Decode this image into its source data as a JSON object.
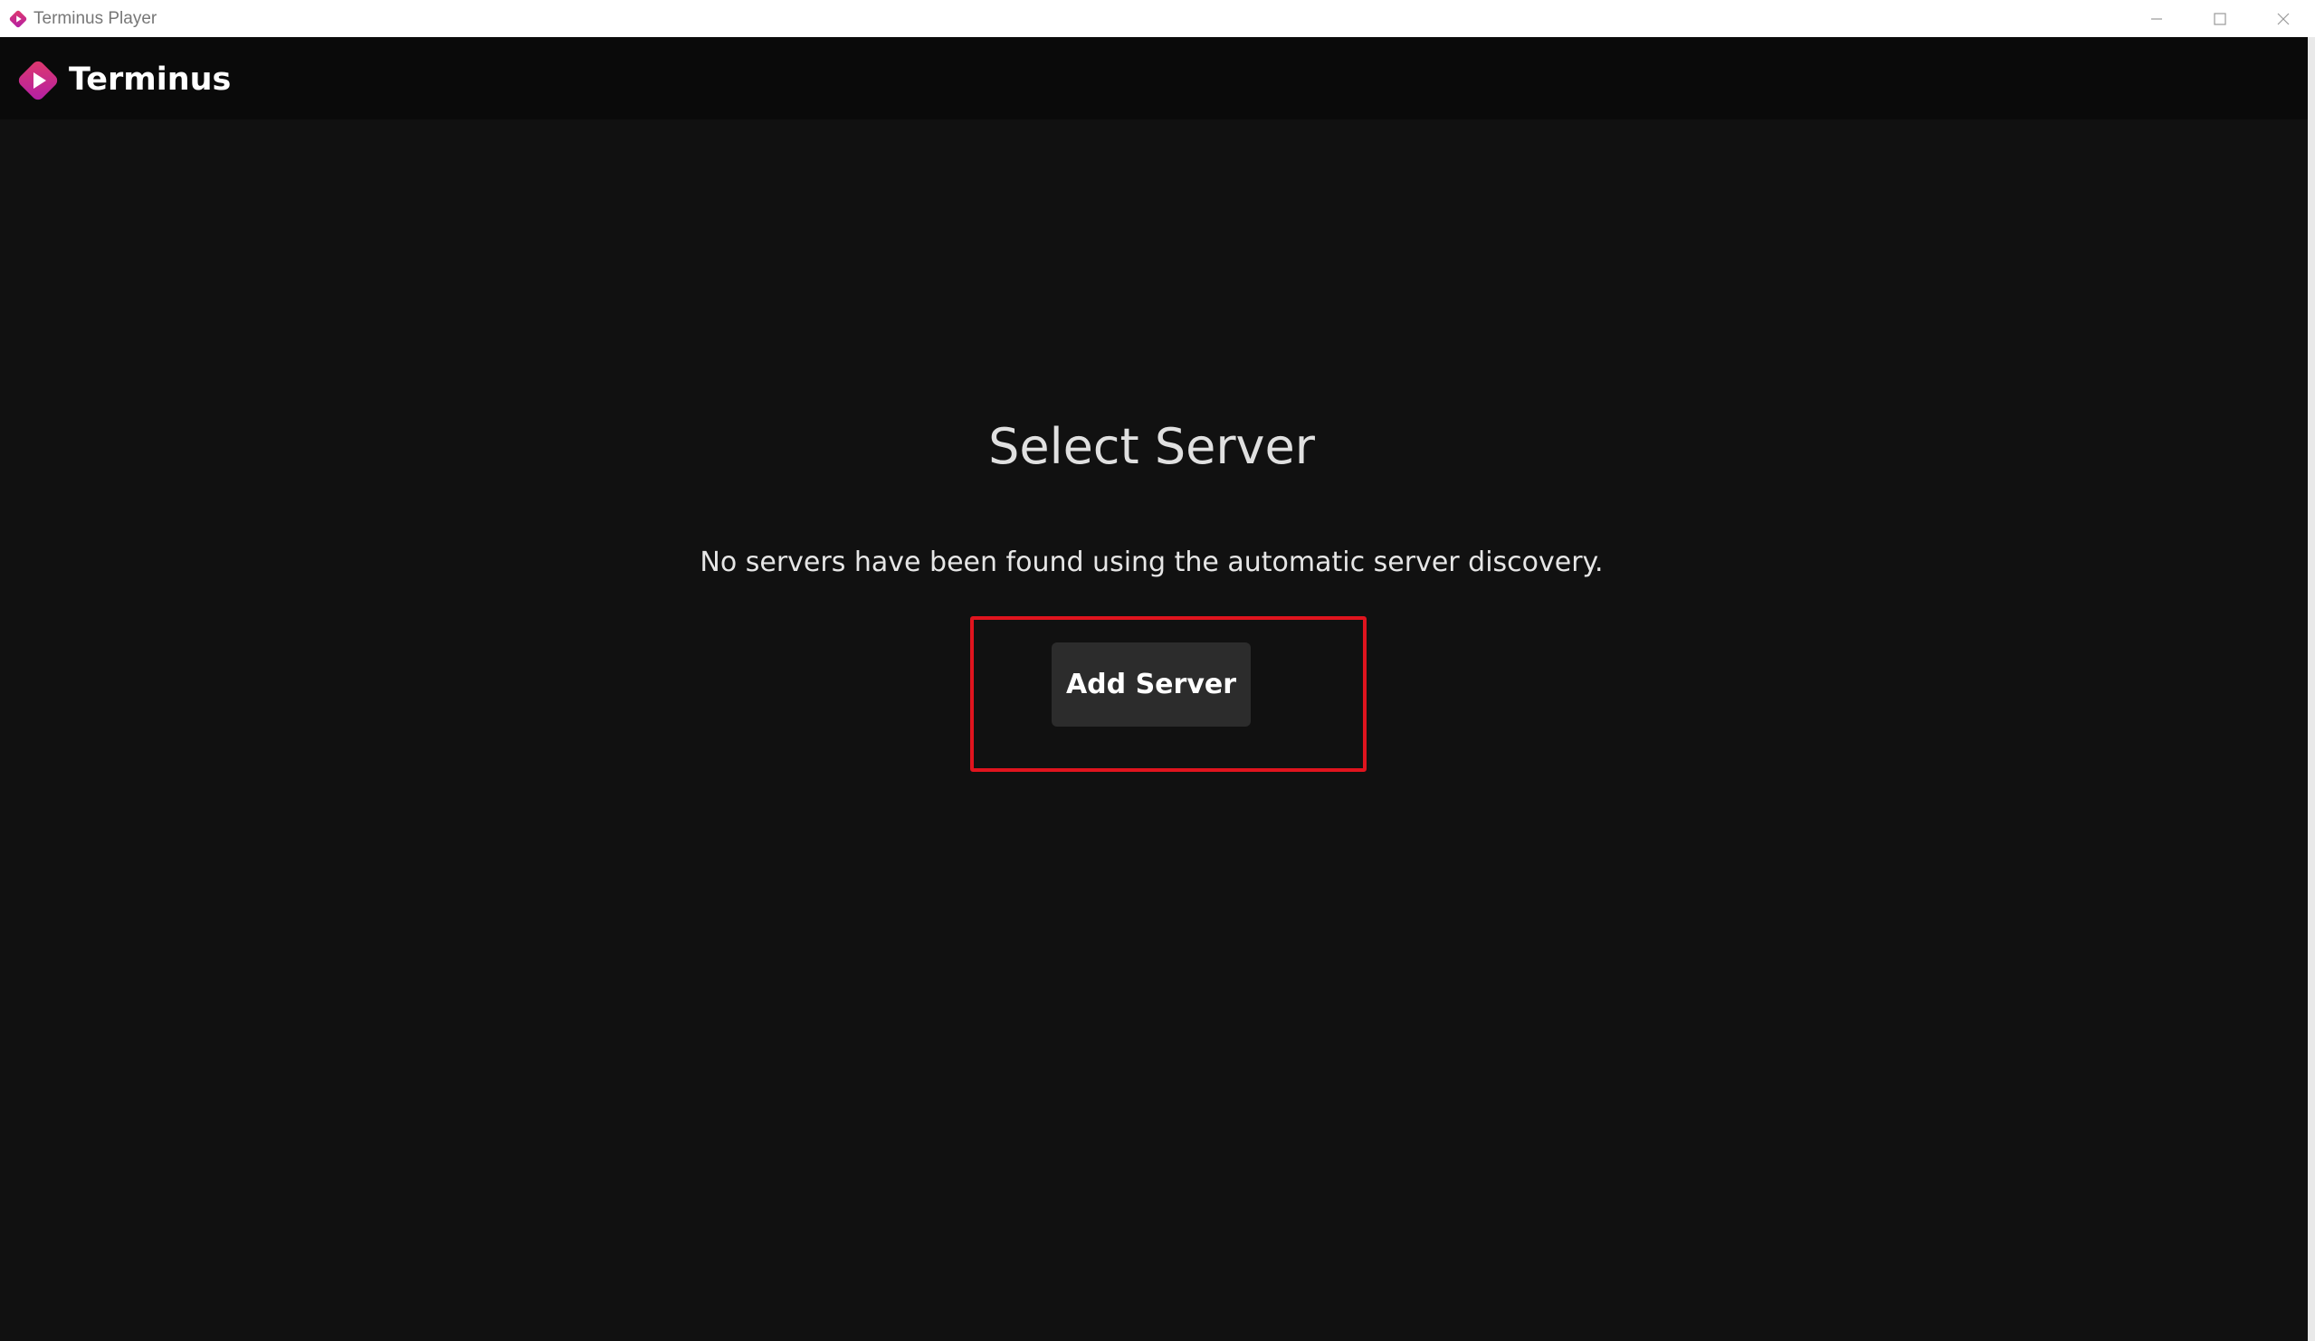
{
  "window": {
    "title": "Terminus Player",
    "controls": {
      "minimize_icon": "minimize-icon",
      "maximize_icon": "maximize-icon",
      "close_icon": "close-icon"
    }
  },
  "header": {
    "brand_name": "Terminus",
    "logo_icon": "terminus-logo-icon",
    "logo_colors": {
      "from": "#e03a6a",
      "to": "#b21ea8",
      "play": "#ffffff"
    }
  },
  "main": {
    "title": "Select Server",
    "message": "No servers have been found using the automatic server discovery.",
    "add_button_label": "Add Server"
  },
  "colors": {
    "background": "#111111",
    "header_bg": "#0a0a0a",
    "button_bg": "#2c2c2c",
    "highlight": "#e0141e"
  }
}
